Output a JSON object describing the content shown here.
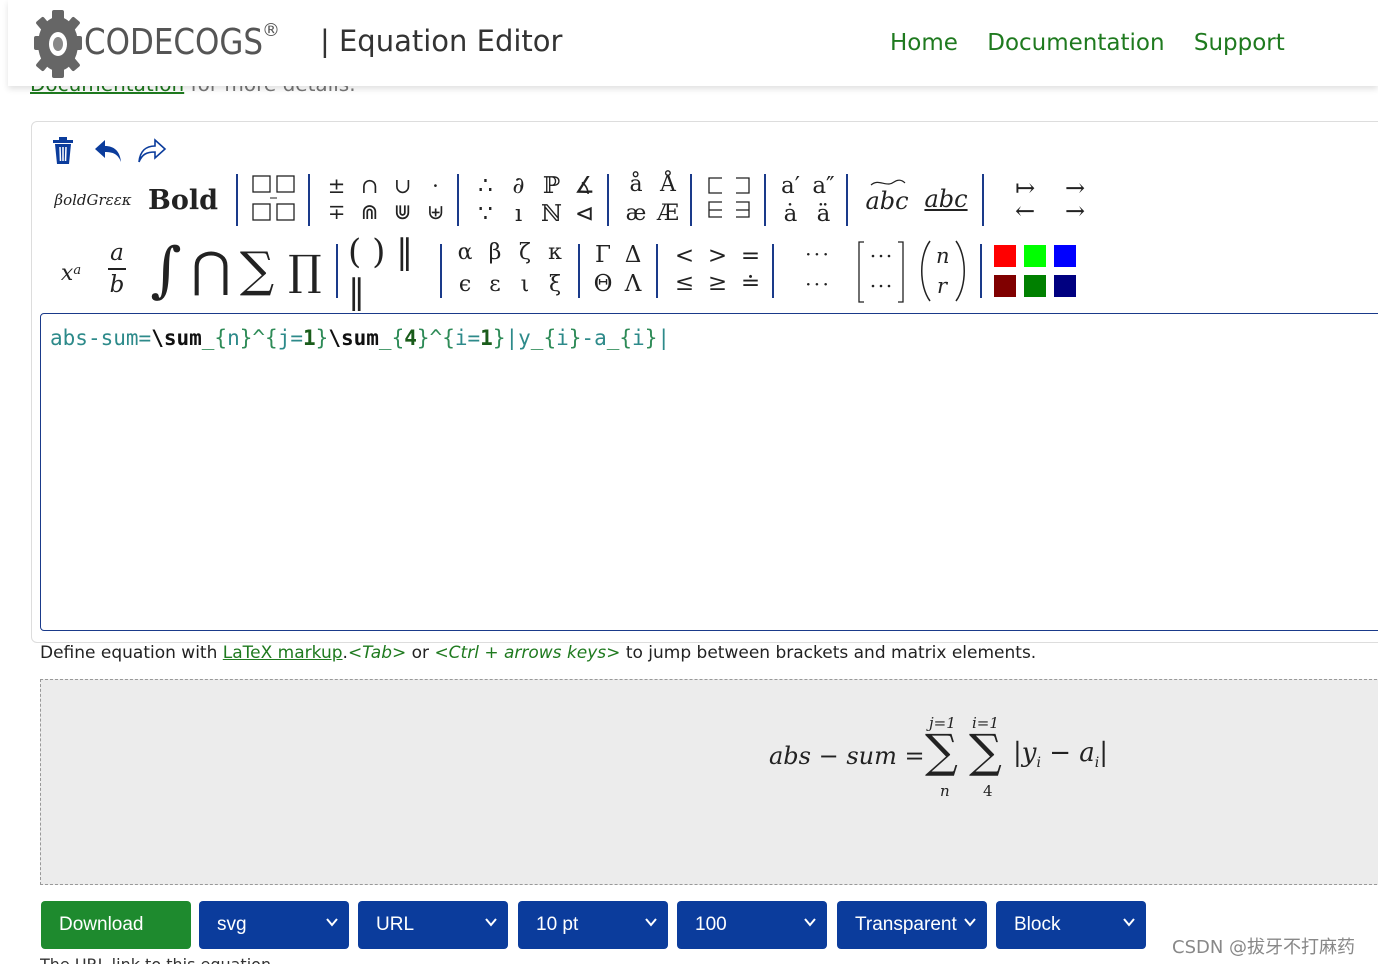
{
  "header": {
    "logo_text": "CODECOGS",
    "logo_reg": "®",
    "title": "| Equation Editor",
    "nav": [
      "Home",
      "Documentation",
      "Support"
    ]
  },
  "clipped_link": {
    "link": "Documentation",
    "rest": " for more details."
  },
  "toolbar": {
    "row1": {
      "boldgreek_label": "βoldGrεεκ",
      "bold_label": "Bold",
      "ops_top": [
        "±",
        "∩",
        "∪",
        "·"
      ],
      "ops_bottom": [
        "∓",
        "⋒",
        "⋓",
        "⊎"
      ],
      "logic_top": [
        "∴",
        "∂",
        "ℙ",
        "∡"
      ],
      "logic_bottom": [
        "∵",
        "ı",
        "ℕ",
        "⊲"
      ],
      "accents_top": [
        "å",
        "Å"
      ],
      "accents_bottom": [
        "æ",
        "Æ"
      ],
      "primes_top": [
        "a′",
        "a″"
      ],
      "primes_bottom": [
        "ȧ",
        "ä"
      ],
      "decor": [
        "abc",
        "abc"
      ],
      "arrows_top": [
        "↦",
        "→"
      ],
      "arrows_bottom": [
        "←",
        "→"
      ]
    },
    "row2": {
      "power_base": "x",
      "power_exp": "a",
      "frac_num": "a",
      "frac_den": "b",
      "big_ops": [
        "∫",
        "⋂",
        "∑",
        "∏"
      ],
      "brackets": "( ) ‖ ‖",
      "greek_top": [
        "α",
        "β",
        "ζ",
        "κ"
      ],
      "greek_bottom": [
        "ϵ",
        "ε",
        "ι",
        "ξ"
      ],
      "caps_top": [
        "Γ",
        "Δ"
      ],
      "caps_bottom": [
        "Θ",
        "Λ"
      ],
      "rel_top": [
        "<",
        ">",
        "="
      ],
      "rel_bottom": [
        "≤",
        "≥",
        "≐"
      ],
      "dots_top": "· · ·",
      "dots_bottom": "· · ·",
      "binom_top": "n",
      "binom_bottom": "r",
      "colors": [
        "#ff0000",
        "#00ff00",
        "#0000ff",
        "#800000",
        "#008000",
        "#000080"
      ]
    }
  },
  "editor": {
    "tokens": [
      {
        "t": "abs",
        "c": "c-plain"
      },
      {
        "t": "-",
        "c": "c-op"
      },
      {
        "t": "sum",
        "c": "c-plain"
      },
      {
        "t": "=",
        "c": "c-plain"
      },
      {
        "t": "\\sum",
        "c": "c-cmd"
      },
      {
        "t": "_",
        "c": "c-brace"
      },
      {
        "t": "{",
        "c": "c-brace"
      },
      {
        "t": "n",
        "c": "c-plain"
      },
      {
        "t": "}",
        "c": "c-brace"
      },
      {
        "t": "^",
        "c": "c-brace"
      },
      {
        "t": "{",
        "c": "c-brace"
      },
      {
        "t": "j",
        "c": "c-plain"
      },
      {
        "t": "=",
        "c": "c-plain"
      },
      {
        "t": "1",
        "c": "c-num"
      },
      {
        "t": "}",
        "c": "c-brace"
      },
      {
        "t": "\\sum",
        "c": "c-cmd"
      },
      {
        "t": "_",
        "c": "c-brace"
      },
      {
        "t": "{",
        "c": "c-brace"
      },
      {
        "t": "4",
        "c": "c-num"
      },
      {
        "t": "}",
        "c": "c-brace"
      },
      {
        "t": "^",
        "c": "c-brace"
      },
      {
        "t": "{",
        "c": "c-brace"
      },
      {
        "t": "i",
        "c": "c-plain"
      },
      {
        "t": "=",
        "c": "c-plain"
      },
      {
        "t": "1",
        "c": "c-num"
      },
      {
        "t": "}",
        "c": "c-brace"
      },
      {
        "t": "|",
        "c": "c-plain"
      },
      {
        "t": "y",
        "c": "c-plain"
      },
      {
        "t": "_",
        "c": "c-brace"
      },
      {
        "t": "{",
        "c": "c-brace"
      },
      {
        "t": "i",
        "c": "c-plain"
      },
      {
        "t": "}",
        "c": "c-brace"
      },
      {
        "t": "-",
        "c": "c-op"
      },
      {
        "t": "a",
        "c": "c-plain"
      },
      {
        "t": "_",
        "c": "c-brace"
      },
      {
        "t": "{",
        "c": "c-brace"
      },
      {
        "t": "i",
        "c": "c-plain"
      },
      {
        "t": "}",
        "c": "c-brace"
      },
      {
        "t": "|",
        "c": "c-plain"
      }
    ]
  },
  "hint": {
    "pre": "Define equation with ",
    "link": "LaTeX markup",
    "mid1": ".",
    "key1": "<Tab>",
    "mid2": " or ",
    "key2": "<Ctrl + arrows keys>",
    "post": " to jump between brackets and matrix elements."
  },
  "preview": {
    "lhs": "abs − sum =",
    "sum1_top": "j=1",
    "sum1_bottom": "n",
    "sum2_top": "i=1",
    "sum2_bottom": "4",
    "sigma": "∑",
    "body_y": "y",
    "body_i1": "i",
    "body_minus": " − ",
    "body_a": "a",
    "body_i2": "i",
    "bar": "|"
  },
  "controls": {
    "download": "Download",
    "format": "svg",
    "link_type": "URL",
    "font_size": "10 pt",
    "dpi": "100",
    "background": "Transparent",
    "display": "Block"
  },
  "watermark": "CSDN @拔牙不打麻药",
  "bottom_cut": "The URL link to this equation"
}
